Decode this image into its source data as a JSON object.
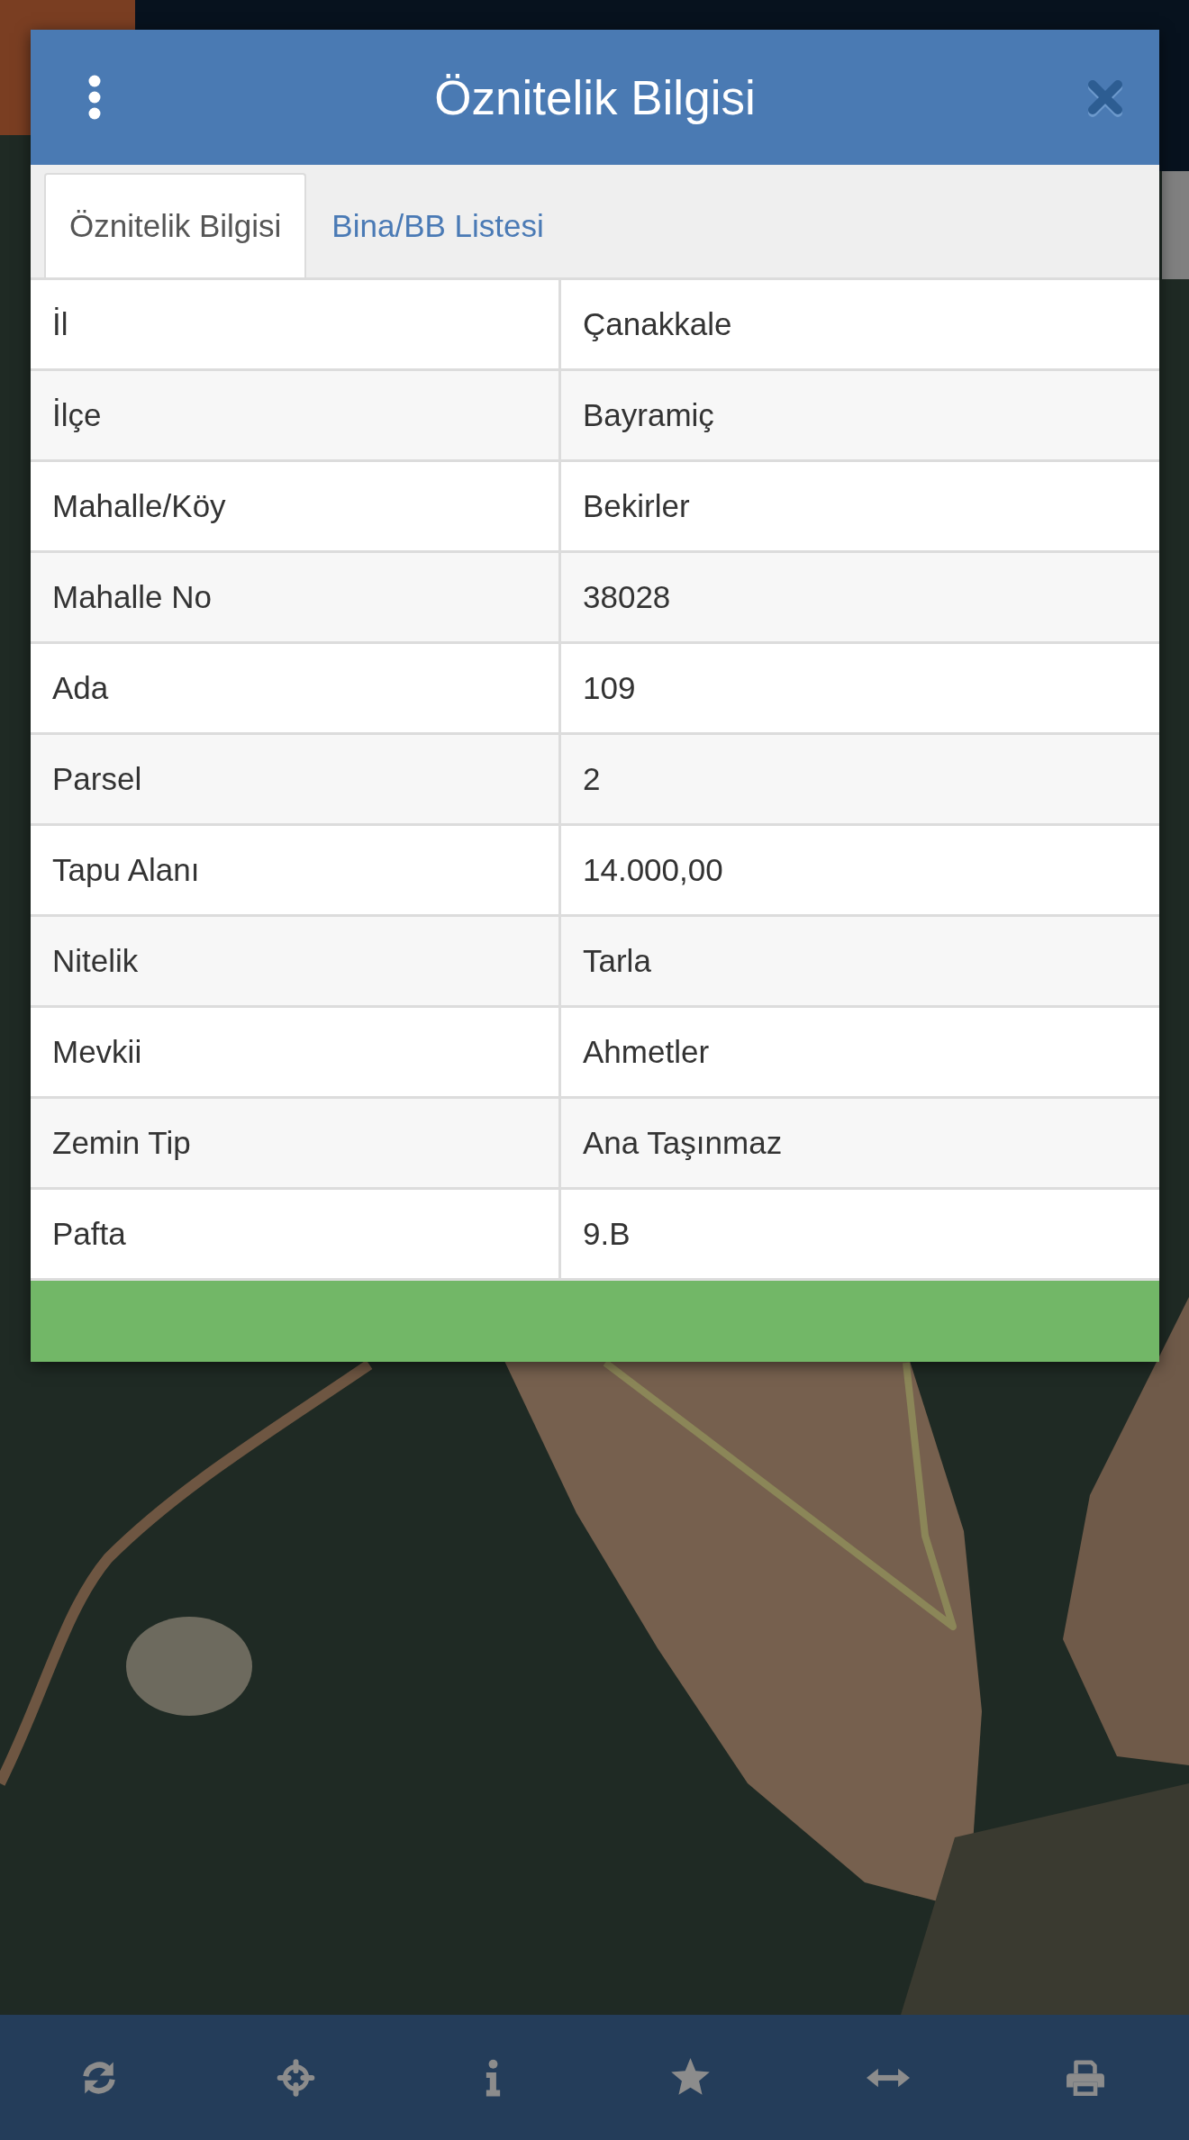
{
  "dialog": {
    "title": "Öznitelik Bilgisi",
    "tabs": [
      {
        "label": "Öznitelik Bilgisi",
        "selected": true
      },
      {
        "label": "Bina/BB Listesi",
        "selected": false
      }
    ],
    "attributes": [
      {
        "label": "İl",
        "value": "Çanakkale"
      },
      {
        "label": "İlçe",
        "value": "Bayramiç"
      },
      {
        "label": "Mahalle/Köy",
        "value": "Bekirler"
      },
      {
        "label": "Mahalle No",
        "value": "38028"
      },
      {
        "label": "Ada",
        "value": "109"
      },
      {
        "label": "Parsel",
        "value": "2"
      },
      {
        "label": "Tapu Alanı",
        "value": "14.000,00"
      },
      {
        "label": "Nitelik",
        "value": "Tarla"
      },
      {
        "label": "Mevkii",
        "value": "Ahmetler"
      },
      {
        "label": "Zemin Tip",
        "value": "Ana Taşınmaz"
      },
      {
        "label": "Pafta",
        "value": "9.B"
      }
    ]
  }
}
